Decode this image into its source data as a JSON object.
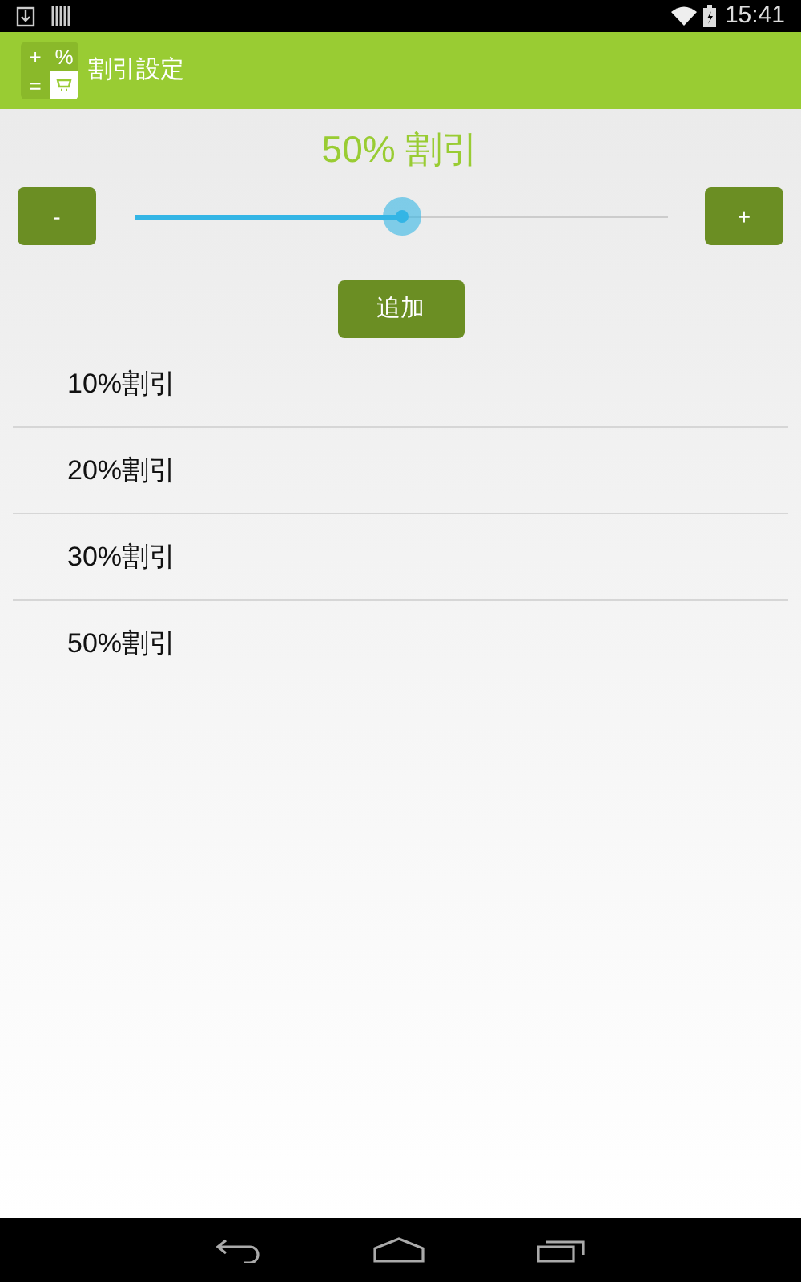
{
  "status_bar": {
    "time": "15:41"
  },
  "app_bar": {
    "icon_symbols": [
      "+",
      "%",
      "="
    ],
    "title": "割引設定"
  },
  "discount_label": "50% 割引",
  "slider": {
    "level": 0.5
  },
  "minus_button": "-",
  "plus_button": "+",
  "add_button": "追加",
  "items": [
    {
      "label": "10%割引"
    },
    {
      "label": "20%割引"
    },
    {
      "label": "30%割引"
    },
    {
      "label": "50%割引"
    }
  ]
}
